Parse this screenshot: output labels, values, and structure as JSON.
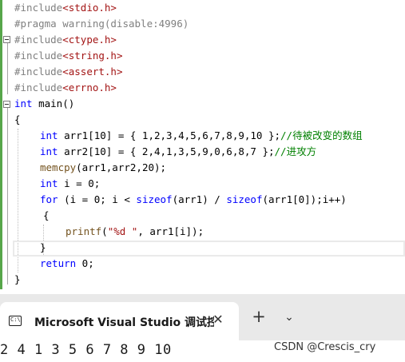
{
  "editor": {
    "lines": [
      [
        {
          "t": "#include",
          "c": "pp"
        },
        {
          "t": "<stdio.h>",
          "c": "inc"
        }
      ],
      [
        {
          "t": "#pragma warning(disable:4996)",
          "c": "pp"
        }
      ],
      [
        {
          "t": "#include",
          "c": "pp"
        },
        {
          "t": "<ctype.h>",
          "c": "inc"
        }
      ],
      [
        {
          "t": "#include",
          "c": "pp"
        },
        {
          "t": "<string.h>",
          "c": "inc"
        }
      ],
      [
        {
          "t": "#include",
          "c": "pp"
        },
        {
          "t": "<assert.h>",
          "c": "inc"
        }
      ],
      [
        {
          "t": "#include",
          "c": "pp"
        },
        {
          "t": "<errno.h>",
          "c": "inc"
        }
      ],
      [
        {
          "t": "int",
          "c": "kw"
        },
        {
          "t": " main()",
          "c": "tk"
        }
      ],
      [
        {
          "t": "{",
          "c": "tk"
        }
      ],
      [
        {
          "t": "int",
          "c": "kw"
        },
        {
          "t": " arr1[10] = { 1,2,3,4,5,6,7,8,9,10 };",
          "c": "tk"
        },
        {
          "t": "//待被改变的数组",
          "c": "cm"
        }
      ],
      [
        {
          "t": "int",
          "c": "kw"
        },
        {
          "t": " arr2[10] = { 2,4,1,3,5,9,0,6,8,7 };",
          "c": "tk"
        },
        {
          "t": "//进攻方",
          "c": "cm"
        }
      ],
      [
        {
          "t": "memcpy",
          "c": "fn"
        },
        {
          "t": "(arr1,arr2,20);",
          "c": "tk"
        }
      ],
      [
        {
          "t": "int",
          "c": "kw"
        },
        {
          "t": " i = 0;",
          "c": "tk"
        }
      ],
      [
        {
          "t": "for",
          "c": "kw"
        },
        {
          "t": " (i = 0; i < ",
          "c": "tk"
        },
        {
          "t": "sizeof",
          "c": "kw"
        },
        {
          "t": "(arr1) / ",
          "c": "tk"
        },
        {
          "t": "sizeof",
          "c": "kw"
        },
        {
          "t": "(arr1[0]);i++)",
          "c": "tk"
        }
      ],
      [
        {
          "t": "{",
          "c": "tk"
        }
      ],
      [
        {
          "t": "printf",
          "c": "fn"
        },
        {
          "t": "(",
          "c": "tk"
        },
        {
          "t": "\"%d \"",
          "c": "str"
        },
        {
          "t": ", arr1[i]);",
          "c": "tk"
        }
      ],
      [
        {
          "t": "}",
          "c": "tk"
        }
      ],
      [
        {
          "t": "return",
          "c": "kw"
        },
        {
          "t": " 0;",
          "c": "tk"
        }
      ],
      [
        {
          "t": "}",
          "c": "tk"
        }
      ]
    ]
  },
  "taskbar": {
    "tab_title": "Microsoft Visual Studio 调试控",
    "tab_icon_text": "C:\\",
    "close_glyph": "✕",
    "new_tab_glyph": "+",
    "menu_glyph": "⌄"
  },
  "console": {
    "output": "2 4 1 3 5 6 7 8 9 10",
    "watermark": "CSDN @Crescis_cry"
  }
}
